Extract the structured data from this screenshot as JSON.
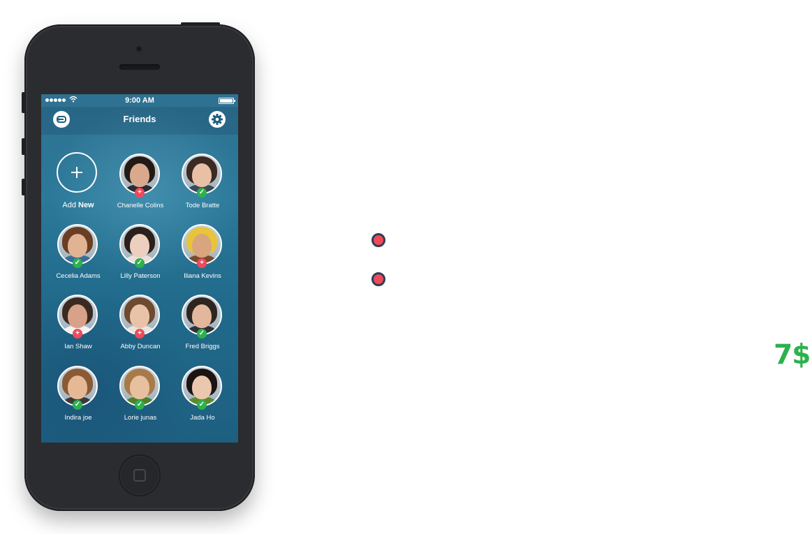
{
  "status_bar": {
    "time": "9:00 AM"
  },
  "nav": {
    "title": "Friends",
    "back_icon": "back-icon",
    "settings_icon": "gear-icon"
  },
  "add_new": {
    "label_prefix": "Add ",
    "label_bold": "New"
  },
  "friends": [
    {
      "name": "Chanelle Colins",
      "status": "add",
      "skin": "#d9a98e",
      "hair": "#231a16",
      "body": "#2a2c33"
    },
    {
      "name": "Tode Bratte",
      "status": "added",
      "skin": "#e8c0a6",
      "hair": "#3a2a22",
      "body": "#3b4a5a"
    },
    {
      "name": "Cecelia Adams",
      "status": "added",
      "skin": "#e0b394",
      "hair": "#6a3e22",
      "body": "#3a6d9a"
    },
    {
      "name": "Lilly Paterson",
      "status": "added",
      "skin": "#edcfbf",
      "hair": "#2b201b",
      "body": "#e8e1da"
    },
    {
      "name": "Iliana Kevins",
      "status": "add",
      "skin": "#d8a57f",
      "hair": "#e8c43a",
      "body": "#7a4a30"
    },
    {
      "name": "Ian Shaw",
      "status": "add",
      "skin": "#d7a287",
      "hair": "#3a2a22",
      "body": "#f2f2f2"
    },
    {
      "name": "Abby Duncan",
      "status": "add",
      "skin": "#e9c3a8",
      "hair": "#6d4a30",
      "body": "#e8e4df"
    },
    {
      "name": "Fred Briggs",
      "status": "added",
      "skin": "#e2b79b",
      "hair": "#2e2520",
      "body": "#2e3138"
    },
    {
      "name": "Indira joe",
      "status": "added",
      "skin": "#e6b996",
      "hair": "#8a5a34",
      "body": "#3a3a3a"
    },
    {
      "name": "Lorie junas",
      "status": "added",
      "skin": "#e7c09f",
      "hair": "#a77a48",
      "body": "#4f7f2a"
    },
    {
      "name": "Jada Ho",
      "status": "added",
      "skin": "#eac8ae",
      "hair": "#1c1412",
      "body": "#5b8a2e"
    }
  ],
  "badges": {
    "add": "+",
    "added": "✓"
  },
  "side": {
    "price": "7$"
  },
  "colors": {
    "accent_red": "#ef4a5b",
    "accent_green": "#2bb24c",
    "dot_border": "#2e3d55"
  }
}
